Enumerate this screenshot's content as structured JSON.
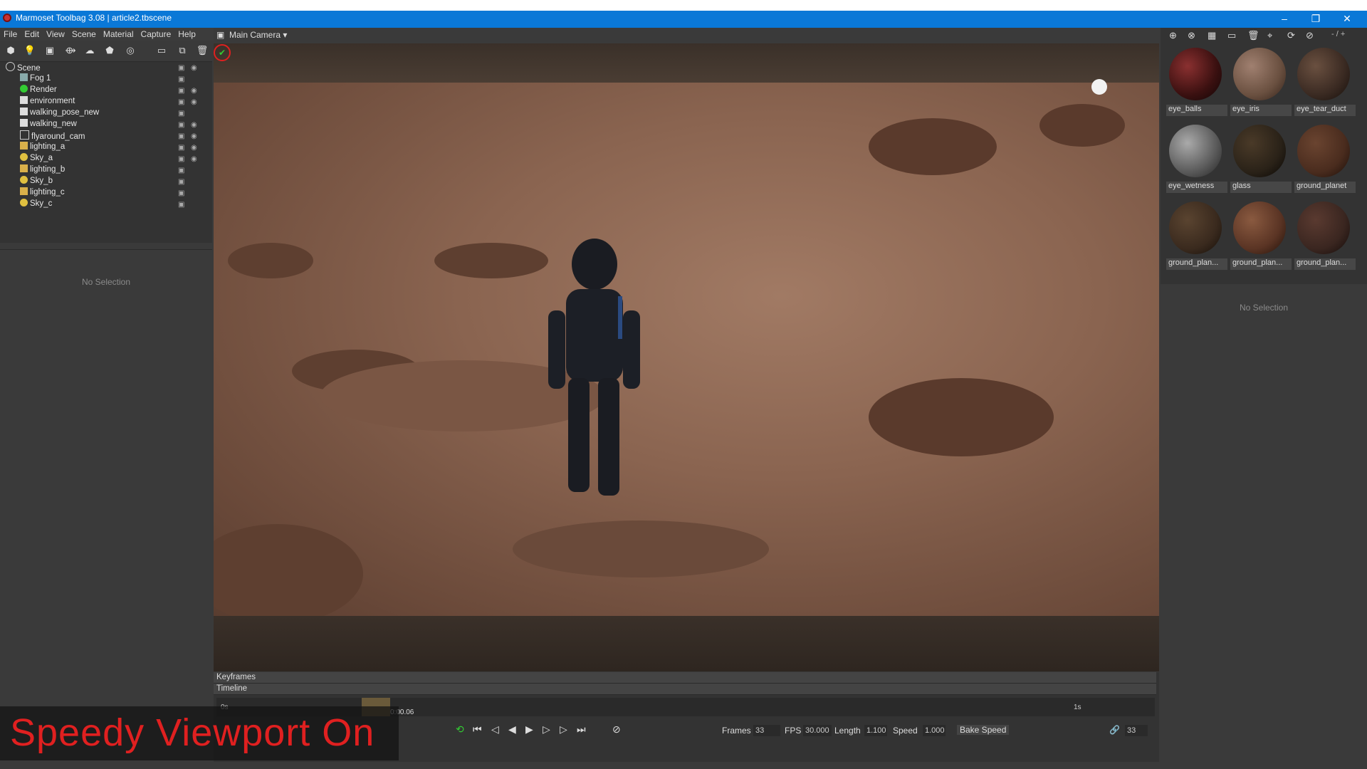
{
  "window": {
    "title": "Marmoset Toolbag 3.08  |  article2.tbscene",
    "minimize": "–",
    "restore": "❐",
    "close": "✕"
  },
  "menu": [
    "File",
    "Edit",
    "View",
    "Scene",
    "Material",
    "Capture",
    "Help"
  ],
  "scene_tree": {
    "root": "Scene",
    "items": [
      "Fog 1",
      "Render",
      "environment",
      "walking_pose_new",
      "walking_new",
      "flyaround_cam",
      "lighting_a",
      "Sky_a",
      "lighting_b",
      "Sky_b",
      "lighting_c",
      "Sky_c"
    ]
  },
  "left_props": {
    "empty_text": "No Selection"
  },
  "viewport": {
    "camera_label": "Main Camera ▾"
  },
  "materials": {
    "page_indicator": "- / +",
    "items": [
      "eye_balls",
      "eye_iris",
      "eye_tear_duct",
      "eye_wetness",
      "glass",
      "ground_planet",
      "ground_plan...",
      "ground_plan...",
      "ground_plan..."
    ],
    "colors": [
      "#3a1010",
      "#6a5040",
      "#3a2a22",
      "#5a5a5a",
      "#2a2218",
      "#4a2c1e",
      "#3a2a1e",
      "#5a3424",
      "#3a2620"
    ]
  },
  "right_props": {
    "empty_text": "No Selection"
  },
  "timeline": {
    "keyframes_label": "Keyframes",
    "timeline_label": "Timeline",
    "start_tick": "0s",
    "end_tick": "1s",
    "current_time": "0:00.06",
    "frames_label": "Frames",
    "frames_value": "33",
    "fps_label": "FPS",
    "fps_value": "30.000",
    "length_label": "Length",
    "length_value": "1.100",
    "speed_label": "Speed",
    "speed_value": "1.000",
    "bake_speed": "Bake Speed",
    "link_value": "33"
  },
  "overlay": {
    "text": "Speedy Viewport On"
  }
}
